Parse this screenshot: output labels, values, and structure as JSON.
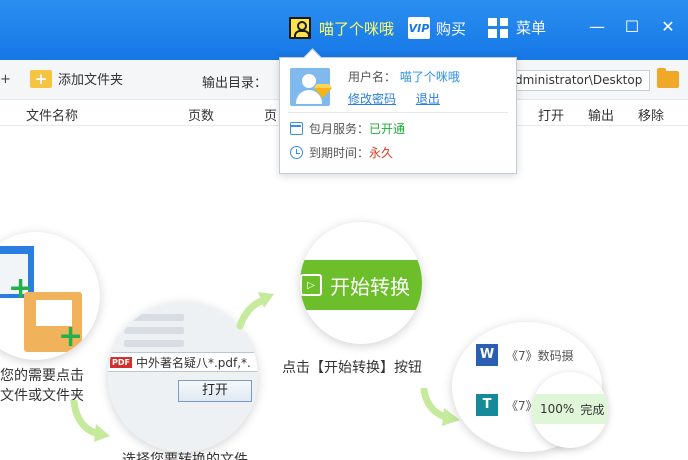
{
  "titlebar": {
    "username": "喵了个咪哦",
    "vip_label": "购买",
    "vip_icon_text": "VIP",
    "menu_label": "菜单",
    "minimize_glyph": "—",
    "maximize_glyph": "☐",
    "close_glyph": "✕",
    "bg_color": "#1677e6"
  },
  "toolbar": {
    "left_cut": "+",
    "add_folder_label": "添加文件夹",
    "output_dir_label": "输出目录：",
    "output_path": "dministrator\\Desktop"
  },
  "columns": {
    "file_name": "文件名称",
    "pages": "页数",
    "pages2": "页",
    "open": "打开",
    "output": "输出",
    "remove": "移除"
  },
  "guide": {
    "step1_line1": "您的需要点击",
    "step1_line2": "文件或文件夹",
    "step2_file": "中外著名疑八*.pdf,*.",
    "step2_pdf": "PDF",
    "step2_open_button": "打开",
    "step2_caption": "选择您要转换的文件",
    "step3_button": "开始转换",
    "step3_caption": "点击【开始转换】按钮",
    "result1": "《7》数码摄",
    "result2": "《7》",
    "word_icon": "W",
    "t_icon": "T",
    "progress": "100%",
    "progress_value": 100,
    "done_label": "完成"
  },
  "popup": {
    "username_label": "用户名：",
    "username": "喵了个咪哦",
    "change_password": "修改密码",
    "logout": "退出",
    "service_label": "包月服务：",
    "service_status": "已开通",
    "expire_label": "到期时间：",
    "expire_value": "永久"
  }
}
